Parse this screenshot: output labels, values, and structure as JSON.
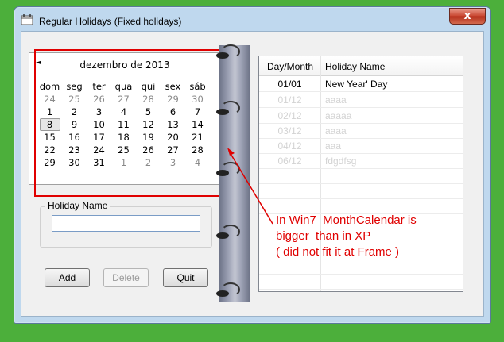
{
  "window": {
    "title": "Regular Holidays (Fixed holidays)",
    "close_glyph": "x"
  },
  "calendar": {
    "prev_glyph": "◄",
    "month_title": "dezembro de 2013",
    "weekdays": [
      "dom",
      "seg",
      "ter",
      "qua",
      "qui",
      "sex",
      "sáb"
    ],
    "weeks": [
      [
        "24",
        "25",
        "26",
        "27",
        "28",
        "29",
        "30"
      ],
      [
        "1",
        "2",
        "3",
        "4",
        "5",
        "6",
        "7"
      ],
      [
        "8",
        "9",
        "10",
        "11",
        "12",
        "13",
        "14"
      ],
      [
        "15",
        "16",
        "17",
        "18",
        "19",
        "20",
        "21"
      ],
      [
        "22",
        "23",
        "24",
        "25",
        "26",
        "27",
        "28"
      ],
      [
        "29",
        "30",
        "31",
        "1",
        "2",
        "3",
        "4"
      ]
    ]
  },
  "holiday_group": {
    "label": "Holiday Name",
    "value": ""
  },
  "buttons": {
    "add": "Add",
    "delete": "Delete",
    "quit": "Quit"
  },
  "list": {
    "columns": [
      "Day/Month",
      "Holiday Name"
    ],
    "rows": [
      {
        "day": "01/01",
        "name": "New Year' Day"
      },
      {
        "day": "01/12",
        "name": "aaaa"
      },
      {
        "day": "02/12",
        "name": "aaaaa"
      },
      {
        "day": "03/12",
        "name": "aaaa"
      },
      {
        "day": "04/12",
        "name": "aaa"
      },
      {
        "day": "06/12",
        "name": "fdgdfsg"
      }
    ]
  },
  "annotation": {
    "line1": "In Win7  MonthCalendar is",
    "line2": "bigger  than in XP",
    "line3": "( did not fit it at Frame )"
  },
  "colors": {
    "annotation_red": "#e00000",
    "desktop_green": "#4caf3b"
  }
}
